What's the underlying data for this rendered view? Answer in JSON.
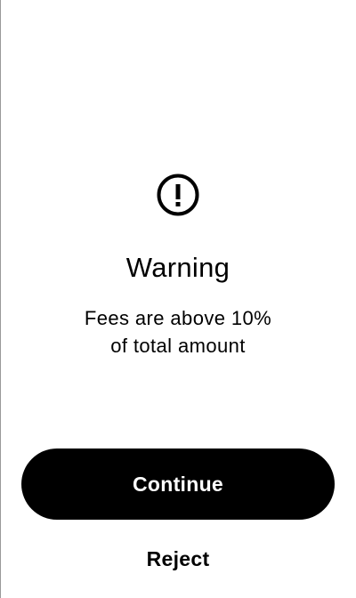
{
  "dialog": {
    "icon": "exclamation-circle-icon",
    "title": "Warning",
    "message": "Fees are above 10%\nof total amount"
  },
  "actions": {
    "continue_label": "Continue",
    "reject_label": "Reject"
  },
  "colors": {
    "background": "#ffffff",
    "text": "#000000",
    "primary_button": "#000000",
    "primary_button_text": "#ffffff"
  }
}
